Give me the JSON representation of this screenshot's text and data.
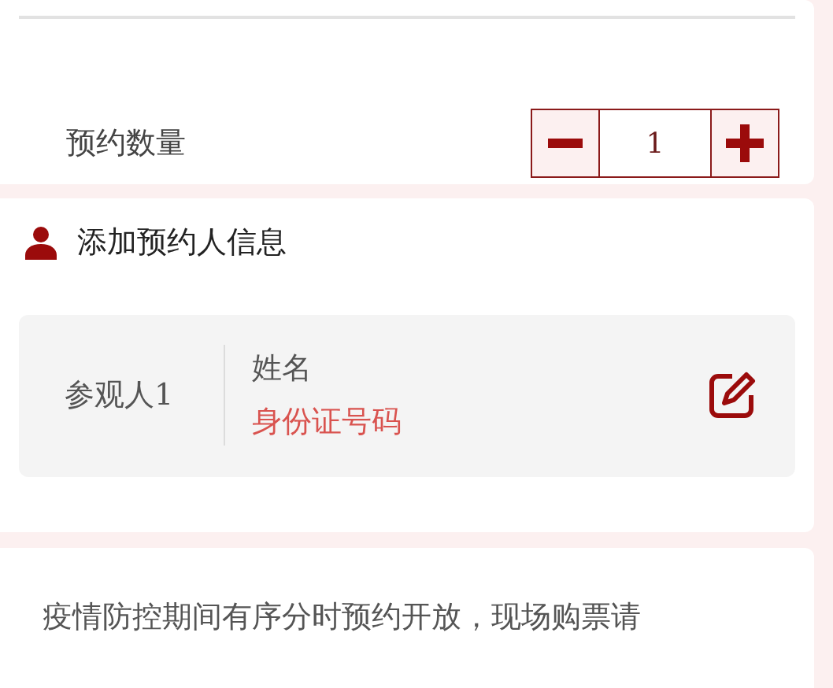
{
  "quantity": {
    "label": "预约数量",
    "value": "1"
  },
  "visitors_section": {
    "title": "添加预约人信息",
    "visitors": [
      {
        "label": "参观人1",
        "name": "姓名",
        "id_number": "身份证号码"
      }
    ]
  },
  "notice": {
    "text": "疫情防控期间有序分时预约开放，现场购票请"
  }
}
